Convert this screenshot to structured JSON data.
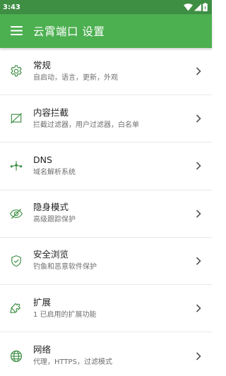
{
  "status_bar": {
    "time": "3:43"
  },
  "app_bar": {
    "title": "云霄端口 设置"
  },
  "colors": {
    "accent": "#4caf50",
    "status_bar": "#3e8e44",
    "icon": "#3e8e44"
  },
  "settings": [
    {
      "title": "常规",
      "subtitle": "自启动，语言，更新，外观",
      "icon": "gear-icon"
    },
    {
      "title": "内容拦截",
      "subtitle": "拦截过滤器，用户过滤器，白名单",
      "icon": "block-icon"
    },
    {
      "title": "DNS",
      "subtitle": "域名解析系统",
      "icon": "dns-icon"
    },
    {
      "title": "隐身模式",
      "subtitle": "高级跟踪保护",
      "icon": "eye-off-icon"
    },
    {
      "title": "安全浏览",
      "subtitle": "钓鱼和恶意软件保护",
      "icon": "shield-check-icon"
    },
    {
      "title": "扩展",
      "subtitle": "1 已启用的扩展功能",
      "icon": "puzzle-icon"
    },
    {
      "title": "网络",
      "subtitle": "代理，HTTPS，过滤模式",
      "icon": "globe-icon"
    }
  ]
}
